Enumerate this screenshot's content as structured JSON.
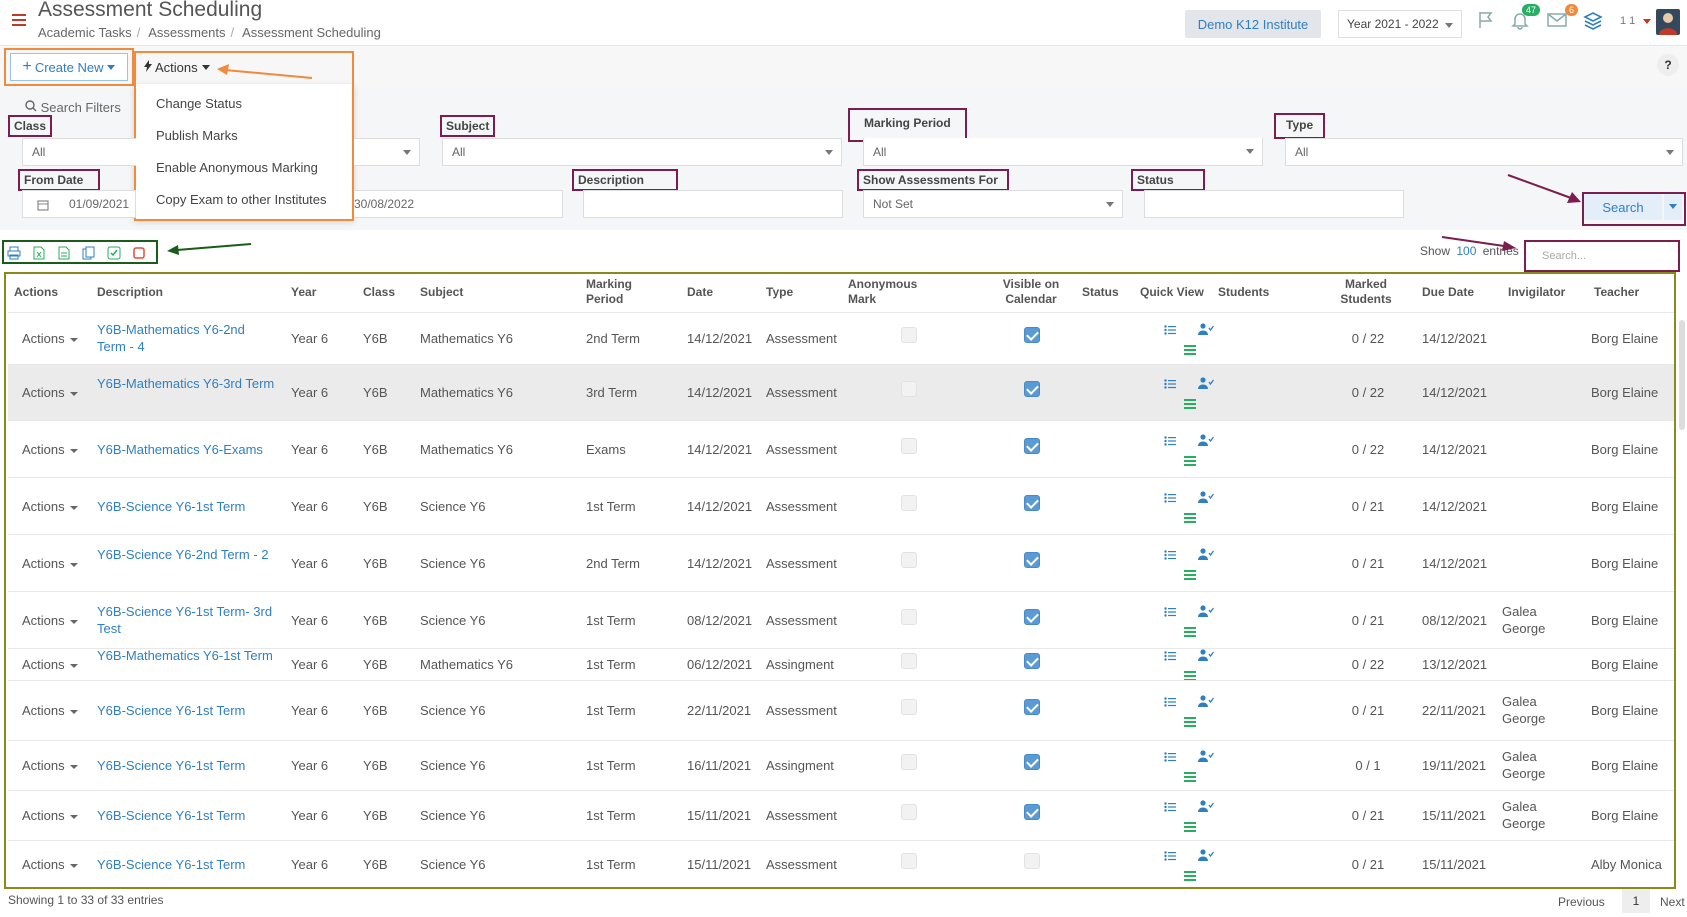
{
  "header": {
    "title": "Assessment Scheduling",
    "breadcrumb": [
      "Academic Tasks",
      "Assessments",
      "Assessment Scheduling"
    ],
    "institute": "Demo K12 Institute",
    "year": "Year 2021 - 2022",
    "notifications_count": "47",
    "messages_count": "6",
    "counter_label": "1 1"
  },
  "toolbar": {
    "create_new": "Create New",
    "actions": "Actions",
    "help": "?",
    "actions_menu": [
      "Change Status",
      "Publish Marks",
      "Enable Anonymous Marking",
      "Copy Exam to other Institutes"
    ]
  },
  "filters": {
    "search_filters": "Search Filters",
    "class_label": "Class",
    "class_value": "All",
    "subject_label": "Subject",
    "subject_value": "All",
    "marking_period_label": "Marking Period",
    "marking_period_value": "All",
    "type_label": "Type",
    "type_value": "All",
    "from_date_label": "From Date",
    "from_date_value": "01/09/2021",
    "to_date_value": "30/08/2022",
    "description_label": "Description",
    "description_value": "",
    "show_for_label": "Show Assessments For",
    "show_for_value": "Not Set",
    "status_label": "Status",
    "status_value": "",
    "search_button": "Search"
  },
  "table_controls": {
    "show": "Show",
    "entries_count": "100",
    "entries": "entries",
    "search_placeholder": "Search..."
  },
  "columns": [
    "Actions",
    "Description",
    "Year",
    "Class",
    "Subject",
    "Marking Period",
    "Date",
    "Type",
    "Anonymous Mark",
    "Visible on Calendar",
    "Status",
    "Quick View",
    "Students",
    "Marked Students",
    "Due Date",
    "Invigilator",
    "Teacher"
  ],
  "rows": [
    {
      "actions": "Actions",
      "description": "Y6B-Mathematics Y6-2nd Term - 4",
      "year": "Year 6",
      "class": "Y6B",
      "subject": "Mathematics Y6",
      "period": "2nd Term",
      "date": "14/12/2021",
      "type": "Assessment",
      "anonymous": false,
      "visible": true,
      "marked": "0 / 22",
      "due": "14/12/2021",
      "invigilator": "",
      "teacher": "Borg Elaine"
    },
    {
      "actions": "Actions",
      "description": "Y6B-Mathematics Y6-3rd Term",
      "year": "Year 6",
      "class": "Y6B",
      "subject": "Mathematics Y6",
      "period": "3rd Term",
      "date": "14/12/2021",
      "type": "Assessment",
      "anonymous": false,
      "visible": true,
      "marked": "0 / 22",
      "due": "14/12/2021",
      "invigilator": "",
      "teacher": "Borg Elaine"
    },
    {
      "actions": "Actions",
      "description": "Y6B-Mathematics Y6-Exams",
      "year": "Year 6",
      "class": "Y6B",
      "subject": "Mathematics Y6",
      "period": "Exams",
      "date": "14/12/2021",
      "type": "Assessment",
      "anonymous": false,
      "visible": true,
      "marked": "0 / 22",
      "due": "14/12/2021",
      "invigilator": "",
      "teacher": "Borg Elaine"
    },
    {
      "actions": "Actions",
      "description": "Y6B-Science Y6-1st Term",
      "year": "Year 6",
      "class": "Y6B",
      "subject": "Science Y6",
      "period": "1st Term",
      "date": "14/12/2021",
      "type": "Assessment",
      "anonymous": false,
      "visible": true,
      "marked": "0 / 21",
      "due": "14/12/2021",
      "invigilator": "",
      "teacher": "Borg Elaine"
    },
    {
      "actions": "Actions",
      "description": "Y6B-Science Y6-2nd Term - 2",
      "year": "Year 6",
      "class": "Y6B",
      "subject": "Science Y6",
      "period": "2nd Term",
      "date": "14/12/2021",
      "type": "Assessment",
      "anonymous": false,
      "visible": true,
      "marked": "0 / 21",
      "due": "14/12/2021",
      "invigilator": "",
      "teacher": "Borg Elaine"
    },
    {
      "actions": "Actions",
      "description": "Y6B-Science Y6-1st Term- 3rd Test",
      "year": "Year 6",
      "class": "Y6B",
      "subject": "Science Y6",
      "period": "1st Term",
      "date": "08/12/2021",
      "type": "Assessment",
      "anonymous": false,
      "visible": true,
      "marked": "0 / 21",
      "due": "08/12/2021",
      "invigilator": "Galea George",
      "teacher": "Borg Elaine"
    },
    {
      "actions": "Actions",
      "description": "Y6B-Mathematics Y6-1st Term",
      "year": "Year 6",
      "class": "Y6B",
      "subject": "Mathematics Y6",
      "period": "1st Term",
      "date": "06/12/2021",
      "type": "Assingment",
      "anonymous": false,
      "visible": true,
      "marked": "0 / 22",
      "due": "13/12/2021",
      "invigilator": "",
      "teacher": "Borg Elaine"
    },
    {
      "actions": "Actions",
      "description": "Y6B-Science Y6-1st Term",
      "year": "Year 6",
      "class": "Y6B",
      "subject": "Science Y6",
      "period": "1st Term",
      "date": "22/11/2021",
      "type": "Assessment",
      "anonymous": false,
      "visible": true,
      "marked": "0 / 21",
      "due": "22/11/2021",
      "invigilator": "Galea George",
      "teacher": "Borg Elaine"
    },
    {
      "actions": "Actions",
      "description": "Y6B-Science Y6-1st Term",
      "year": "Year 6",
      "class": "Y6B",
      "subject": "Science Y6",
      "period": "1st Term",
      "date": "16/11/2021",
      "type": "Assingment",
      "anonymous": false,
      "visible": true,
      "marked": "0 / 1",
      "due": "19/11/2021",
      "invigilator": "Galea George",
      "teacher": "Borg Elaine"
    },
    {
      "actions": "Actions",
      "description": "Y6B-Science Y6-1st Term",
      "year": "Year 6",
      "class": "Y6B",
      "subject": "Science Y6",
      "period": "1st Term",
      "date": "15/11/2021",
      "type": "Assessment",
      "anonymous": false,
      "visible": true,
      "marked": "0 / 21",
      "due": "15/11/2021",
      "invigilator": "Galea George",
      "teacher": "Borg Elaine"
    },
    {
      "actions": "Actions",
      "description": "Y6B-Science Y6-1st Term",
      "year": "Year 6",
      "class": "Y6B",
      "subject": "Science Y6",
      "period": "1st Term",
      "date": "15/11/2021",
      "type": "Assessment",
      "anonymous": false,
      "visible": false,
      "marked": "0 / 21",
      "due": "15/11/2021",
      "invigilator": "",
      "teacher": "Alby Monica"
    }
  ],
  "footer": {
    "info": "Showing 1 to 33 of 33 entries",
    "previous": "Previous",
    "page": "1",
    "next": "Next"
  },
  "colors": {
    "link": "#2f7fc1",
    "annotation_orange": "#f08a3c",
    "annotation_purple": "#7b1d4e",
    "annotation_green": "#1a5c1a",
    "annotation_olive": "#8a8a1a",
    "checkbox_on": "#5b9bd5"
  }
}
